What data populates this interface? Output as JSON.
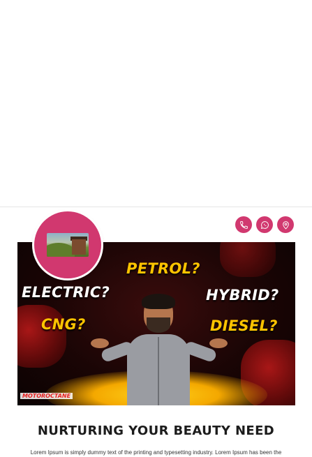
{
  "profile": {
    "logo_name": "logo"
  },
  "contact_buttons": [
    {
      "icon": "phone-icon"
    },
    {
      "icon": "whatsapp-icon"
    },
    {
      "icon": "location-pin-icon"
    }
  ],
  "banner": {
    "words": {
      "petrol": "PETROL?",
      "electric": "ELECTRIC?",
      "hybrid": "HYBRID?",
      "cng": "CNG?",
      "diesel": "DIESEL?"
    },
    "brand": "MOTOROCTANE"
  },
  "content": {
    "heading": "NURTURING YOUR BEAUTY NEED",
    "description": "Lorem Ipsum is simply dummy text of the printing and typesetting industry. Lorem Ipsum has been the"
  },
  "colors": {
    "accent": "#d1386f",
    "banner_yellow": "#ffc400"
  }
}
